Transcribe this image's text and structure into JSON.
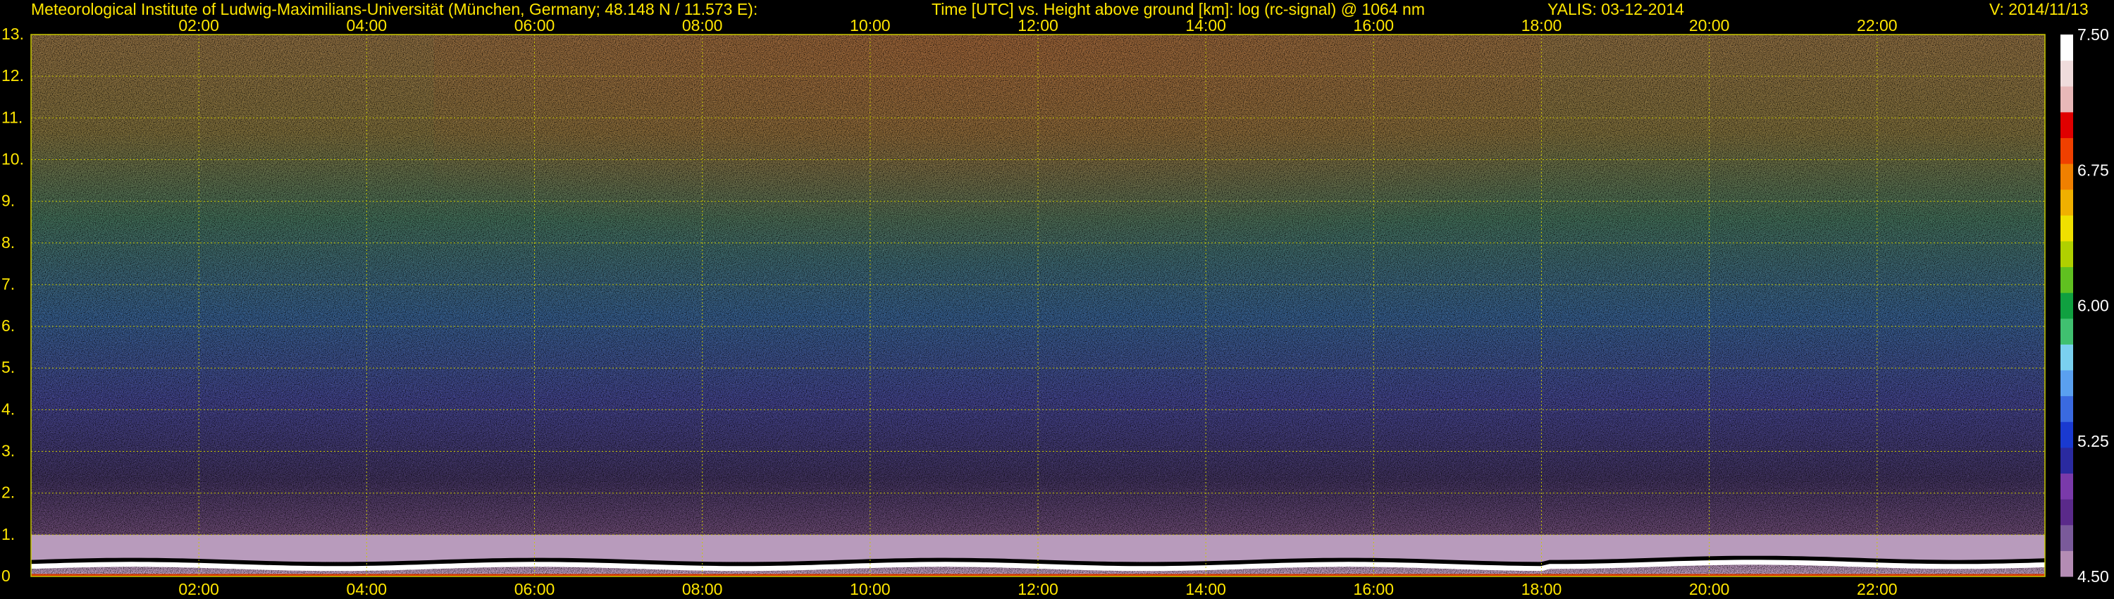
{
  "header": {
    "institute": "Meteorological Institute of Ludwig-Maximilians-Universität (München, Germany; 48.148 N / 11.573 E):",
    "plot_title": "Time [UTC] vs. Height above ground [km]: log (rc-signal) @ 1064 nm",
    "instrument_date": "YALIS: 03-12-2014",
    "version": "V: 2014/11/13"
  },
  "colors": {
    "text": "#ffe600",
    "grid": "#c8c800",
    "background": "#000000"
  },
  "chart_data": {
    "type": "heatmap",
    "title": "Time [UTC] vs. Height above ground [km]: log (rc-signal) @ 1064 nm",
    "xlabel": "Time [UTC]",
    "ylabel": "Height above ground [km]",
    "x_ticks": [
      "02:00",
      "04:00",
      "06:00",
      "08:00",
      "10:00",
      "12:00",
      "14:00",
      "16:00",
      "18:00",
      "20:00",
      "22:00"
    ],
    "x_tick_hours": [
      2,
      4,
      6,
      8,
      10,
      12,
      14,
      16,
      18,
      20,
      22
    ],
    "xlim_hours": [
      0,
      24
    ],
    "y_ticks": [
      "0",
      "1.",
      "2.",
      "3.",
      "4.",
      "5.",
      "6.",
      "7.",
      "8.",
      "9.",
      "10.",
      "11.",
      "12.",
      "13."
    ],
    "y_tick_values": [
      0,
      1,
      2,
      3,
      4,
      5,
      6,
      7,
      8,
      9,
      10,
      11,
      12,
      13
    ],
    "ylim_km": [
      0,
      13
    ],
    "grid": true,
    "colorbar": {
      "ticks": [
        "4.50",
        "5.25",
        "6.00",
        "6.75",
        "7.50"
      ],
      "tick_values": [
        4.5,
        5.25,
        6.0,
        6.75,
        7.5
      ],
      "range": [
        4.5,
        7.5
      ],
      "colors": [
        "#b48cb4",
        "#7a5a9a",
        "#5a2a8a",
        "#7a3aaa",
        "#2a2aa0",
        "#1a3ad0",
        "#3a6ae0",
        "#5aa0f0",
        "#7ad0f0",
        "#40c070",
        "#10a040",
        "#60c020",
        "#b0d000",
        "#f0e000",
        "#f0b000",
        "#f08000",
        "#f04000",
        "#e00000",
        "#e8b8b8",
        "#f0dcdc",
        "#ffffff"
      ]
    }
  }
}
